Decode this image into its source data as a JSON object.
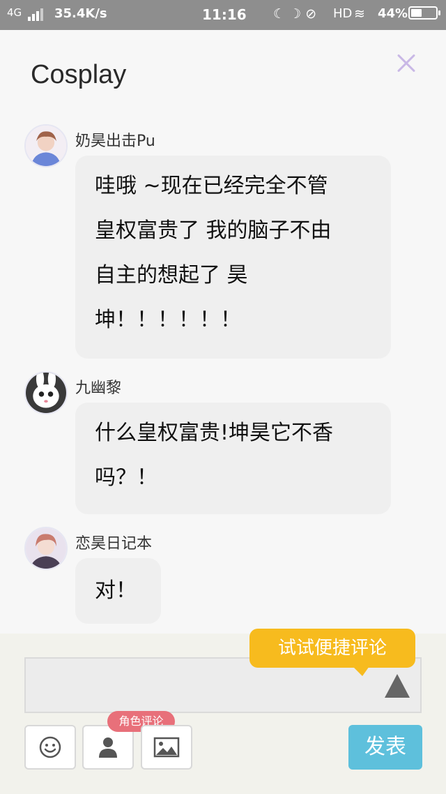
{
  "status_bar": {
    "network": "4G",
    "speed": "35.4K/s",
    "time": "11:16",
    "hd": "HD",
    "battery": "44%",
    "battery_level": 0.44
  },
  "header": {
    "title": "Cosplay"
  },
  "comments": [
    {
      "username": "奶昊出击Pu",
      "lines": [
        "哇哦 ~现在已经完全不管",
        "皇权富贵了 我的脑子不由",
        "自主的想起了 昊",
        "坤！！！！！！"
      ]
    },
    {
      "username": "九幽黎",
      "lines": [
        "什么皇权富贵!坤昊它不香",
        "吗？！"
      ]
    },
    {
      "username": "恋昊日记本",
      "lines": [
        "对！"
      ]
    }
  ],
  "composer": {
    "input_value": "",
    "tip": "试试便捷评论",
    "role_badge": "角色评论",
    "publish_label": "发表",
    "icons": [
      "emoji-icon",
      "person-icon",
      "image-icon",
      "send-arrow-icon"
    ]
  },
  "colors": {
    "status_bar": "#8e8e8e",
    "tip_yellow": "#f7bb1e",
    "publish_blue": "#5ec0dc",
    "badge_pink": "#e8707a",
    "close_lavender": "#c9b8e6"
  }
}
